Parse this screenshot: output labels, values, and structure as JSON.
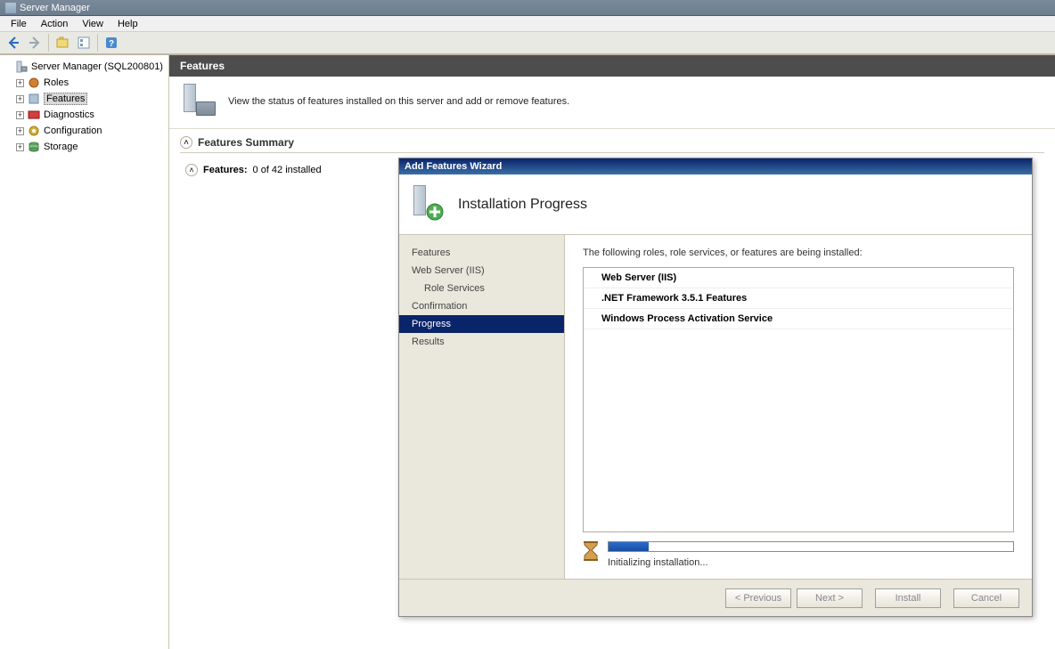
{
  "window": {
    "title": "Server Manager"
  },
  "menubar": [
    "File",
    "Action",
    "View",
    "Help"
  ],
  "tree": {
    "root": "Server Manager (SQL200801)",
    "items": [
      {
        "label": "Roles"
      },
      {
        "label": "Features",
        "selected": true
      },
      {
        "label": "Diagnostics"
      },
      {
        "label": "Configuration"
      },
      {
        "label": "Storage"
      }
    ]
  },
  "content": {
    "header": "Features",
    "description": "View the status of features installed on this server and add or remove features."
  },
  "summary": {
    "title": "Features Summary",
    "features_label": "Features:",
    "features_value": "0 of 42 installed"
  },
  "wizard": {
    "title": "Add Features Wizard",
    "banner_title": "Installation Progress",
    "nav": [
      {
        "label": "Features"
      },
      {
        "label": "Web Server (IIS)"
      },
      {
        "label": "Role Services",
        "sub": true
      },
      {
        "label": "Confirmation"
      },
      {
        "label": "Progress",
        "active": true
      },
      {
        "label": "Results"
      }
    ],
    "intro": "The following roles, role services, or features are being installed:",
    "install_items": [
      "Web Server (IIS)",
      ".NET Framework 3.5.1 Features",
      "Windows Process Activation Service"
    ],
    "progress_percent": 10,
    "progress_text": "Initializing installation...",
    "buttons": {
      "previous": "< Previous",
      "next": "Next >",
      "install": "Install",
      "cancel": "Cancel"
    }
  }
}
